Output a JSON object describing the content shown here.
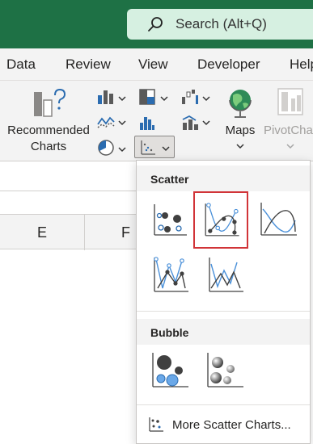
{
  "search": {
    "icon": "search-icon",
    "placeholder": "Search (Alt+Q)"
  },
  "tabs": [
    "Data",
    "Review",
    "View",
    "Developer",
    "Help"
  ],
  "ribbon": {
    "recommended_line1": "Recommended",
    "recommended_line2": "Charts",
    "maps": "Maps",
    "pivot": "PivotChart"
  },
  "columns": [
    "E",
    "F"
  ],
  "dropdown": {
    "scatter_heading": "Scatter",
    "bubble_heading": "Bubble",
    "more_label": "More Scatter Charts...",
    "selected_item": "scatter-smooth-lines-markers"
  },
  "colors": {
    "excel_green": "#1e7145",
    "highlight_red": "#d13438",
    "chart_blue": "#4a90d9"
  }
}
